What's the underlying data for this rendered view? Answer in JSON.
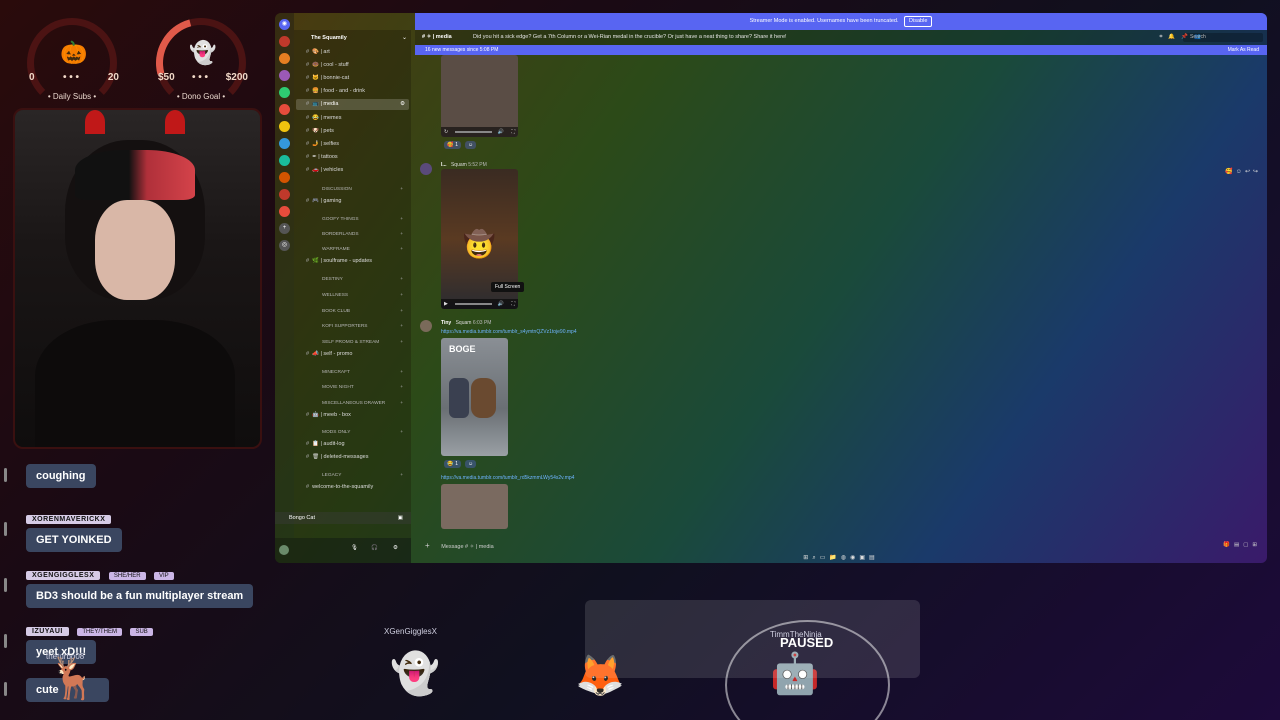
{
  "overlay": {
    "subs_goal": {
      "low": "0",
      "high": "20",
      "dots": "• • •",
      "title": "• Daily Subs •",
      "emoji": "🎃"
    },
    "dono_goal": {
      "low": "$50",
      "high": "$200",
      "dots": "• • •",
      "title": "• Dono Goal •",
      "emoji": "👻"
    },
    "chat": [
      {
        "user": "",
        "tags": [],
        "text": "coughing"
      },
      {
        "user": "XORENMAVERICKX",
        "tags": [],
        "text": "GET YOINKED"
      },
      {
        "user": "XGENGIGGLESX",
        "tags": [
          "SHE/HER",
          "VIP"
        ],
        "text": "BD3 should be a fun multiplayer stream"
      },
      {
        "user": "IZUYAUI",
        "tags": [
          "THEY/THEM",
          "SUB"
        ],
        "text": "yeet xD!!!"
      },
      {
        "user": "",
        "tags": [],
        "text": "cute"
      }
    ],
    "floating_names": [
      "XGenGigglesX",
      "theturbo08"
    ],
    "paused_label": "PAUSED",
    "paused_sub": "TimmTheNinja"
  },
  "discord": {
    "banner_text": "Streamer Mode is enabled. Usernames have been truncated.",
    "banner_button": "Disable",
    "server_name": "The Squamily",
    "channels": [
      {
        "name": "art",
        "emoji": "🎨",
        "active": false
      },
      {
        "name": "cool - stuff",
        "emoji": "🍩",
        "active": false
      },
      {
        "name": "bonnie-cat",
        "emoji": "🐱",
        "active": false
      },
      {
        "name": "food - and - drink",
        "emoji": "🍔",
        "active": false
      },
      {
        "name": "media",
        "emoji": "📺",
        "active": true
      },
      {
        "name": "memes",
        "emoji": "😂",
        "active": false
      },
      {
        "name": "pets",
        "emoji": "🐶",
        "active": false
      },
      {
        "name": "selfies",
        "emoji": "🤳",
        "active": false
      },
      {
        "name": "tattoos",
        "emoji": "✒",
        "active": false
      },
      {
        "name": "vehicles",
        "emoji": "🚗",
        "active": false
      }
    ],
    "sections": [
      {
        "category": "DISCUSSION",
        "channels": [
          "gaming"
        ]
      },
      {
        "category": "GOOFY THINGS",
        "channels": []
      },
      {
        "category": "BORDERLANDS",
        "channels": []
      },
      {
        "category": "WARFRAME",
        "channels": [
          "soulframe - updates"
        ]
      },
      {
        "category": "DESTINY",
        "channels": []
      },
      {
        "category": "WELLNESS",
        "channels": []
      },
      {
        "category": "BOOK CLUB",
        "channels": []
      },
      {
        "category": "KOFI SUPPORTERS",
        "channels": []
      },
      {
        "category": "SELF PROMO & STREAM",
        "channels": [
          "self - promo"
        ]
      },
      {
        "category": "MINECRAFT",
        "channels": []
      },
      {
        "category": "MOVIE NIGHT",
        "channels": []
      },
      {
        "category": "MISCELLANEOUS DRAWER",
        "channels": [
          "meeb - box"
        ]
      },
      {
        "category": "MODS ONLY",
        "channels": [
          "audit-log",
          "deleted-messages"
        ]
      },
      {
        "category": "LEGACY",
        "channels": [
          "welcome-to-the-squamily"
        ]
      }
    ],
    "voice_channel": "Bongo Cat",
    "header": {
      "channel": "media",
      "topic": "Did you hit a sick edge? Get a 7th Column or a Wei-Rian medal in the crucible? Or just have a neat thing to share? Share it here!",
      "search_placeholder": "Search"
    },
    "new_messages": {
      "text": "16 new messages since 5:08 PM",
      "mark": "Mark As Read"
    },
    "messages": [
      {
        "author": "I...",
        "role": "Squam",
        "time": "5:52 PM",
        "reaction": "1"
      },
      {
        "author": "Tiny",
        "role": "Squam",
        "time": "6:03 PM",
        "link1": "https://va.media.tumblr.com/tumblr_s4ymtnQZVz1toje90.mp4",
        "reaction": "1",
        "link2": "https://va.media.tumblr.com/tumblr_rd5kzmmLWy54s2v.mp4",
        "image_caption": "BOGE"
      }
    ],
    "tooltip": "Full Screen",
    "composer_placeholder": "Message #  ✧ | media"
  },
  "colors": {
    "accent": "#5865f2",
    "link": "#6eb4ff"
  }
}
